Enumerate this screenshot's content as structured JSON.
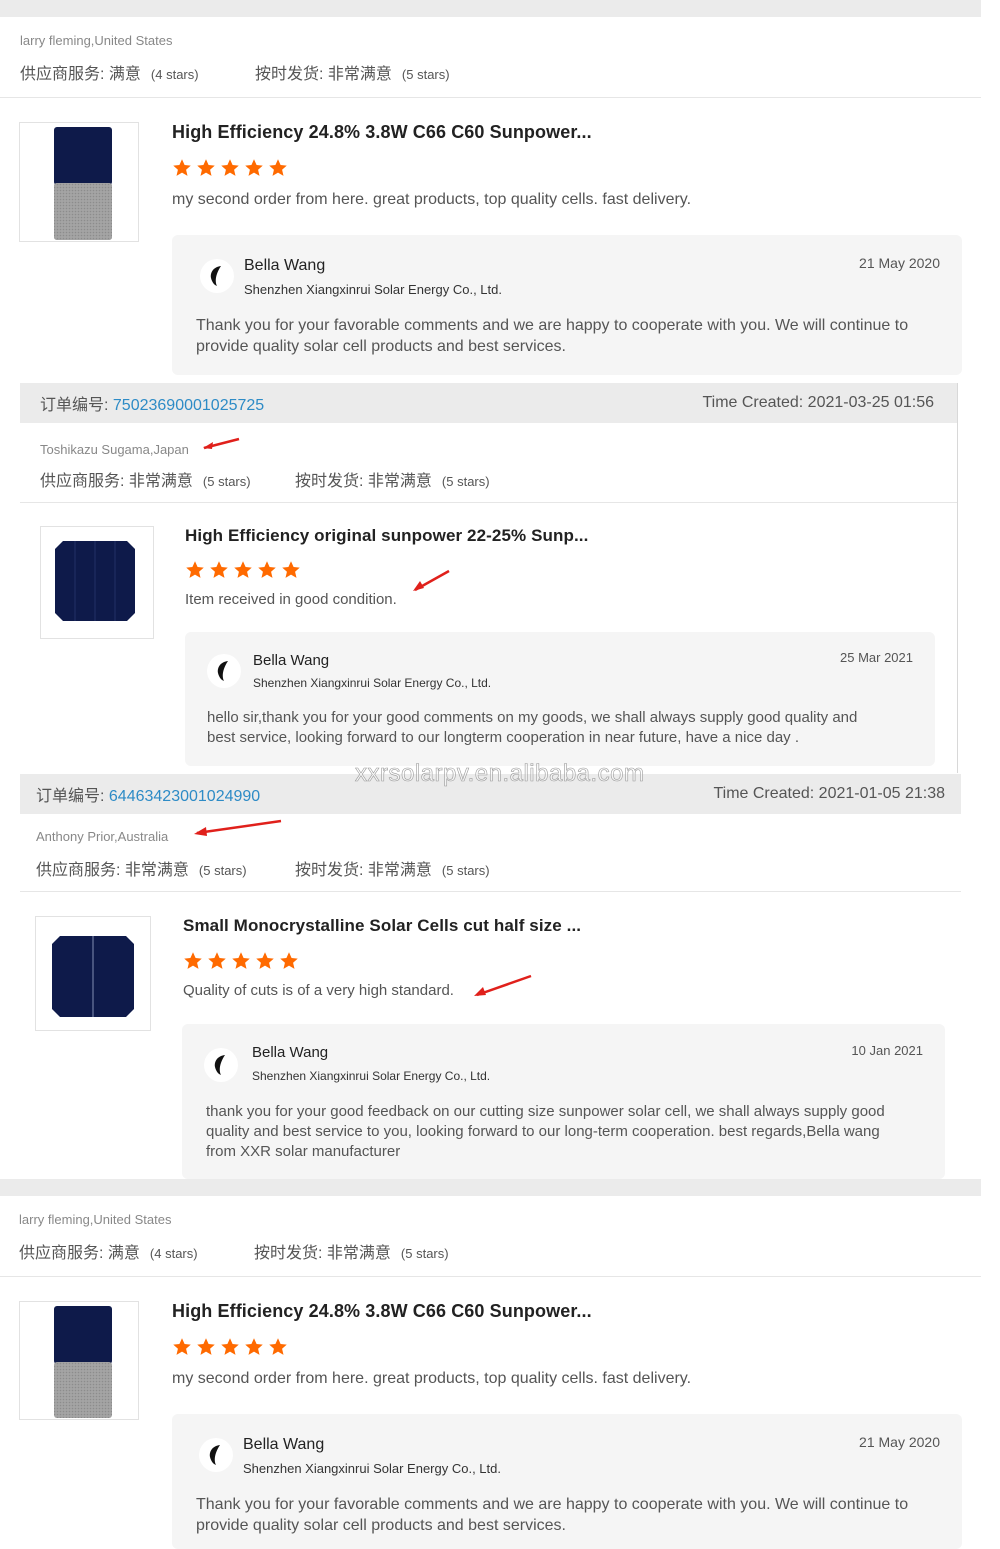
{
  "reviews": [
    {
      "reviewer": "larry fleming,United States",
      "service_label": "供应商服务: 满意",
      "service_stars": "(4 stars)",
      "shipping_label": "按时发货: 非常满意",
      "shipping_stars": "(5 stars)",
      "product_title": "High Efficiency 24.8% 3.8W C66 C60 Sunpower...",
      "rating": 5,
      "comment": "my second order from here. great products, top quality cells. fast delivery.",
      "reply": {
        "name": "Bella Wang",
        "company": "Shenzhen Xiangxinrui Solar Energy Co., Ltd.",
        "date": "21 May 2020",
        "text_lines": [
          "Thank you for your favorable comments and we are happy to cooperate with you. We will continue to",
          "provide quality solar cell products and best services."
        ]
      }
    },
    {
      "order_label": "订单编号",
      "order_number": "75023690001025725",
      "time_created": "Time Created: 2021-03-25 01:56",
      "reviewer": "Toshikazu Sugama,Japan",
      "service_label": "供应商服务: 非常满意",
      "service_stars": "(5 stars)",
      "shipping_label": "按时发货: 非常满意",
      "shipping_stars": "(5 stars)",
      "product_title": "High Efficiency original sunpower 22-25% Sunp...",
      "rating": 5,
      "comment": "Item received in good condition.",
      "reply": {
        "name": "Bella Wang",
        "company": "Shenzhen Xiangxinrui Solar Energy Co., Ltd.",
        "date": "25 Mar 2021",
        "text_lines": [
          "hello sir,thank you for your good comments on my goods, we shall always supply good quality and",
          "best service, looking forward to our longterm cooperation in near future, have a nice day ."
        ]
      }
    },
    {
      "order_label": "订单编号",
      "order_number": "64463423001024990",
      "time_created": "Time Created: 2021-01-05 21:38",
      "reviewer": "Anthony Prior,Australia",
      "service_label": "供应商服务: 非常满意",
      "service_stars": "(5 stars)",
      "shipping_label": "按时发货: 非常满意",
      "shipping_stars": "(5 stars)",
      "product_title": "Small Monocrystalline Solar Cells cut half size ...",
      "rating": 5,
      "comment": "Quality of cuts is of a very high standard.",
      "reply": {
        "name": "Bella Wang",
        "company": "Shenzhen Xiangxinrui Solar Energy Co., Ltd.",
        "date": "10 Jan 2021",
        "text_lines": [
          "thank you for your good feedback on our cutting size sunpower solar cell, we shall always supply good",
          "quality and best service to you, looking forward to our long-term cooperation. best regards,Bella wang",
          "from XXR solar manufacturer"
        ]
      }
    },
    {
      "reviewer": "larry fleming,United States",
      "service_label": "供应商服务: 满意",
      "service_stars": "(4 stars)",
      "shipping_label": "按时发货: 非常满意",
      "shipping_stars": "(5 stars)",
      "product_title": "High Efficiency 24.8% 3.8W C66 C60 Sunpower...",
      "rating": 5,
      "comment": "my second order from here. great products, top quality cells. fast delivery.",
      "reply": {
        "name": "Bella Wang",
        "company": "Shenzhen Xiangxinrui Solar Energy Co., Ltd.",
        "date": "21 May 2020",
        "text_lines": [
          "Thank you for your favorable comments and we are happy to cooperate with you. We will continue to",
          "provide quality solar cell products and best services."
        ]
      }
    }
  ],
  "watermark": "xxrsolarpv.en.alibaba.com",
  "colors": {
    "star": "#ff6a00",
    "link": "#2d8bc6",
    "arrow": "#e0201b",
    "cell": "#0e1a4a"
  },
  "icons": {
    "star": "star-icon",
    "avatar": "company-logo-icon",
    "arrow": "red-arrow-icon"
  }
}
